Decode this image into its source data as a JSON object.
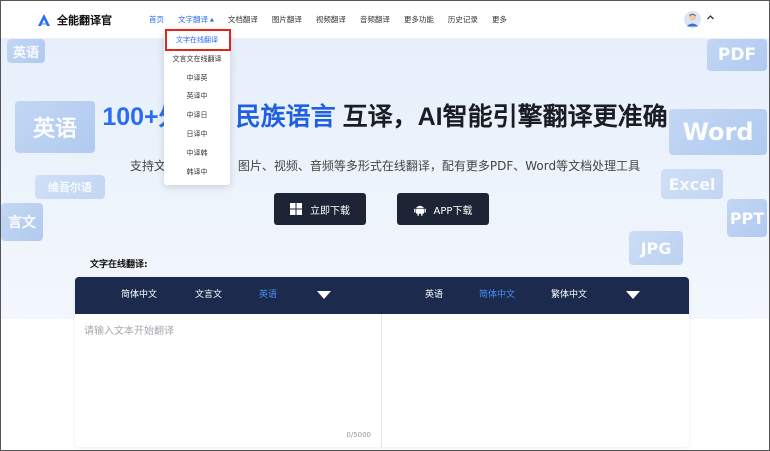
{
  "header": {
    "brand": "全能翻译官",
    "nav": [
      {
        "label": "首页",
        "active": true
      },
      {
        "label": "文字翻译",
        "open": true
      },
      {
        "label": "文档翻译"
      },
      {
        "label": "图片翻译"
      },
      {
        "label": "视频翻译"
      },
      {
        "label": "音频翻译"
      },
      {
        "label": "更多功能"
      },
      {
        "label": "历史记录"
      },
      {
        "label": "更多"
      }
    ],
    "accent_color": "#2a6df4"
  },
  "dropdown": {
    "items": [
      "文字在线翻译",
      "文言文在线翻译",
      "中译英",
      "英译中",
      "中译日",
      "日译中",
      "中译韩",
      "韩译中"
    ],
    "highlight_color": "#e0251c"
  },
  "hero": {
    "title_part1": "100+外",
    "title_part2": "民族语言",
    "title_part3": "互译，AI智能引擎翻译更准确",
    "subtitle_part1": "支持文字",
    "subtitle_part2": "图片、视频、音频等多形式在线翻译，配有更多PDF、Word等文档处理工具",
    "download_button": "立即下载",
    "app_button": "APP下载",
    "tiles": {
      "english": "英语",
      "vernacular": "言文",
      "uyghur": "维吾尔语",
      "pdf": "PDF",
      "word": "Word",
      "excel": "Excel",
      "ppt": "PPT",
      "jpg": "JPG",
      "ying": "英语"
    }
  },
  "translator": {
    "section_label": "文字在线翻译:",
    "source_langs": [
      {
        "label": "简体中文",
        "selected": false
      },
      {
        "label": "文言文",
        "selected": false
      },
      {
        "label": "英语",
        "selected": true
      }
    ],
    "target_langs": [
      {
        "label": "英语",
        "selected": false
      },
      {
        "label": "简体中文",
        "selected": true
      },
      {
        "label": "繁体中文",
        "selected": false
      }
    ],
    "placeholder": "请输入文本开始翻译",
    "char_count": "0/5000",
    "bar_color": "#1c2b4d"
  }
}
